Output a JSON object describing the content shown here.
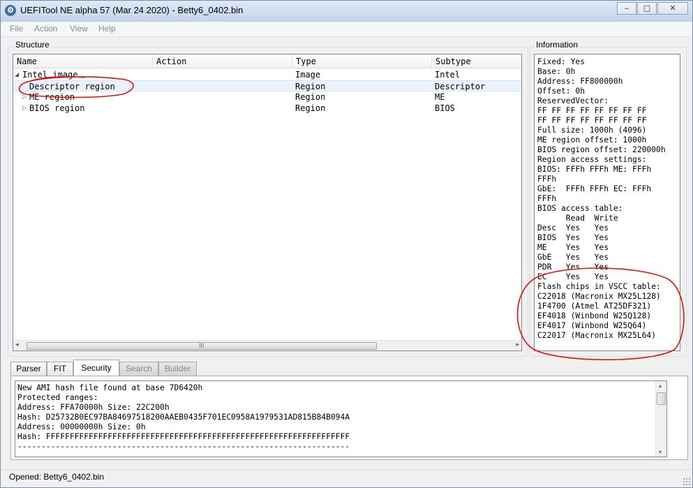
{
  "window": {
    "title": "UEFITool NE alpha 57 (Mar 24 2020) - Betty6_0402.bin",
    "icon_name": "gear-icon",
    "controls": {
      "minimize": "‒",
      "maximize": "□",
      "close": "✕"
    }
  },
  "menu": {
    "items": [
      "File",
      "Action",
      "View",
      "Help"
    ]
  },
  "structure": {
    "label": "Structure",
    "columns": [
      "Name",
      "Action",
      "Type",
      "Subtype"
    ],
    "rows": [
      {
        "name": "Intel image",
        "action": "",
        "type": "Image",
        "subtype": "Intel",
        "expander": "◢"
      },
      {
        "name": "Descriptor region",
        "action": "",
        "type": "Region",
        "subtype": "Descriptor",
        "expander": ""
      },
      {
        "name": "ME region",
        "action": "",
        "type": "Region",
        "subtype": "ME",
        "expander": "▷"
      },
      {
        "name": "BIOS region",
        "action": "",
        "type": "Region",
        "subtype": "BIOS",
        "expander": "▷"
      }
    ],
    "scroll_grip": "III",
    "scroll_left": "◂",
    "scroll_right": "▸"
  },
  "information": {
    "label": "Information",
    "text": "Fixed: Yes\nBase: 0h\nAddress: FF800000h\nOffset: 0h\nReservedVector:\nFF FF FF FF FF FF FF FF\nFF FF FF FF FF FF FF FF\nFull size: 1000h (4096)\nME region offset: 1000h\nBIOS region offset: 220000h\nRegion access settings:\nBIOS: FFFh FFFh ME: FFFh\nFFFh\nGbE:  FFFh FFFh EC: FFFh\nFFFh\nBIOS access table:\n      Read  Write\nDesc  Yes   Yes\nBIOS  Yes   Yes\nME    Yes   Yes\nGbE   Yes   Yes\nPDR   Yes   Yes\nEC    Yes   Yes\nFlash chips in VSCC table:\nC22018 (Macronix MX25L128)\n1F4700 (Atmel AT25DF321)\nEF4018 (Winbond W25Q128)\nEF4017 (Winbond W25Q64)\nC22017 (Macronix MX25L64)"
  },
  "tabs": [
    {
      "label": "Parser",
      "state": "normal"
    },
    {
      "label": "FIT",
      "state": "normal"
    },
    {
      "label": "Security",
      "state": "active"
    },
    {
      "label": "Search",
      "state": "disabled"
    },
    {
      "label": "Builder",
      "state": "disabled"
    }
  ],
  "security_log": {
    "text": "New AMI hash file found at base 7D6420h\nProtected ranges:\nAddress: FFA70000h Size: 22C200h\nHash: D25732B0EC97BA84697518200AAEB0435F701EC0958A1979531AD815B84B094A\nAddress: 00000000h Size: 0h\nHash: FFFFFFFFFFFFFFFFFFFFFFFFFFFFFFFFFFFFFFFFFFFFFFFFFFFFFFFFFFFFFFFF\n----------------------------------------------------------------------",
    "scroll_up": "▴",
    "scroll_down": "▾"
  },
  "status": {
    "text": "Opened: Betty6_0402.bin"
  },
  "colors": {
    "annotation": "#e01010",
    "selection": "#eaf2fb",
    "titlebar": "#c4d5ea"
  }
}
